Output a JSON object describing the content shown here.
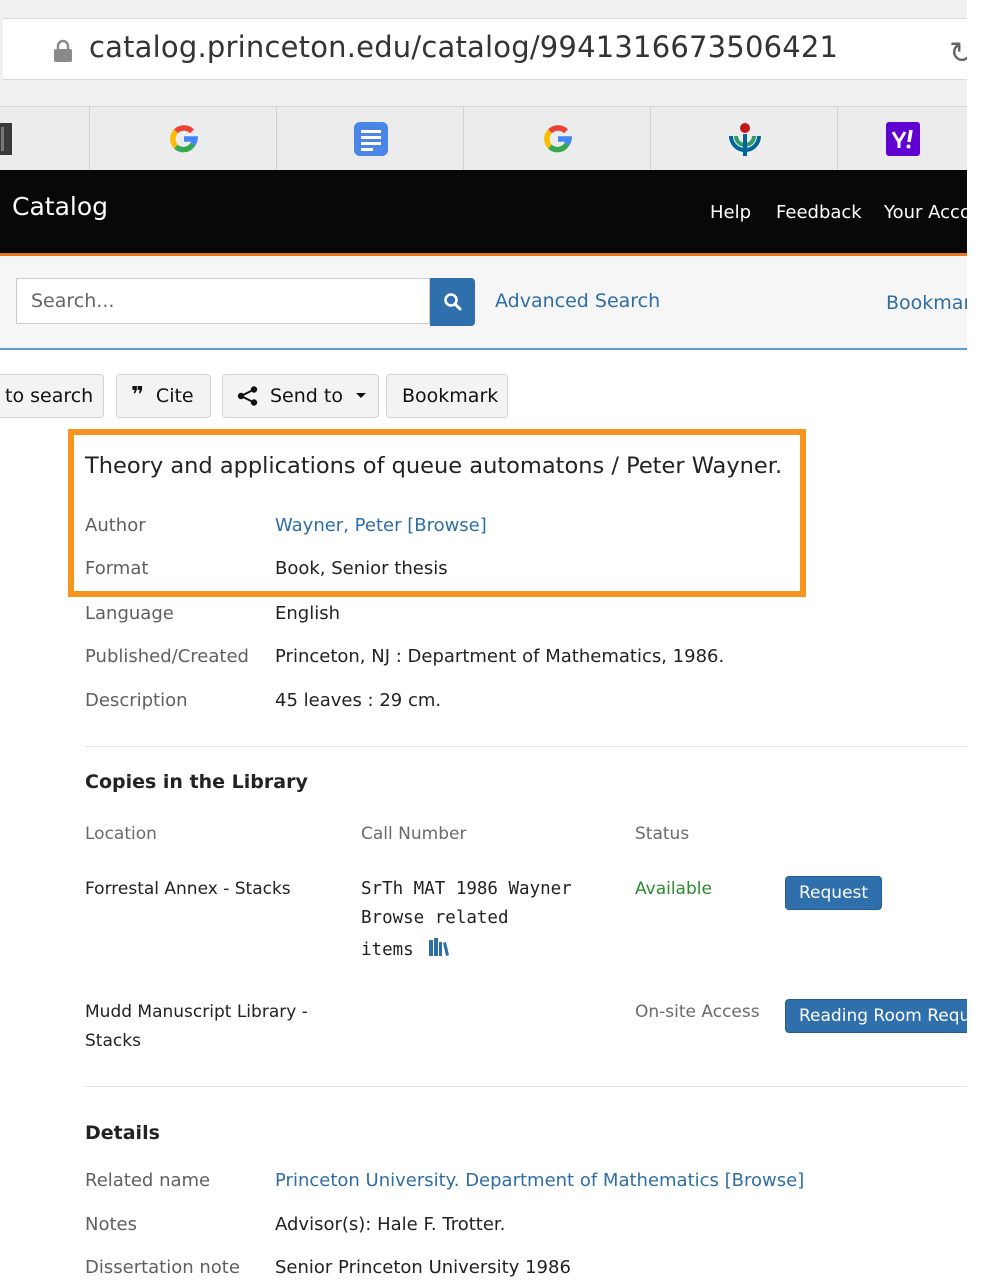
{
  "browser": {
    "url": "catalog.princeton.edu/catalog/9941316673506421",
    "favorites": [
      "partial-icon",
      "google-icon",
      "docs-icon",
      "google-icon",
      "wikimedia-icon",
      "yahoo-icon"
    ]
  },
  "header": {
    "brand": "Catalog",
    "nav": [
      "Help",
      "Feedback",
      "Your Acco"
    ]
  },
  "search": {
    "placeholder": "Search...",
    "advanced": "Advanced Search",
    "bookmarks": "Bookmar"
  },
  "toolbar": {
    "back": "to search",
    "cite": "Cite",
    "send_to": "Send to",
    "bookmark": "Bookmark"
  },
  "record": {
    "title": "Theory and applications of queue automatons / Peter Wayner.",
    "fields": [
      {
        "label": "Author",
        "value": "Wayner, Peter [Browse]"
      },
      {
        "label": "Format",
        "value": "Book, Senior thesis"
      },
      {
        "label": "Language",
        "value": "English"
      },
      {
        "label": "Published/Created",
        "value": "Princeton, NJ : Department of Mathematics, 1986."
      },
      {
        "label": "Description",
        "value": "45 leaves : 29 cm."
      }
    ]
  },
  "copies": {
    "heading": "Copies in the Library",
    "columns": [
      "Location",
      "Call Number",
      "Status"
    ],
    "rows": [
      {
        "location": "Forrestal Annex - Stacks",
        "call_number": "SrTh MAT 1986 Wayner",
        "browse_line1": "Browse related",
        "browse_line2": "items",
        "status": "Available",
        "action": "Request"
      },
      {
        "location_line1": "Mudd Manuscript Library -",
        "location_line2": "Stacks",
        "status": "On-site Access",
        "action": "Reading Room Reque"
      }
    ]
  },
  "details": {
    "heading": "Details",
    "fields": [
      {
        "label": "Related name",
        "value": "Princeton University. Department of Mathematics [Browse]"
      },
      {
        "label": "Notes",
        "value": "Advisor(s): Hale F. Trotter."
      },
      {
        "label": "Dissertation note",
        "value": "Senior Princeton University 1986"
      }
    ]
  },
  "colors": {
    "header_bg": "#080808",
    "accent_orange": "#f7941d",
    "link_blue": "#2e6ea6",
    "button_blue": "#2f6fac",
    "available_green": "#2e8a2e"
  }
}
